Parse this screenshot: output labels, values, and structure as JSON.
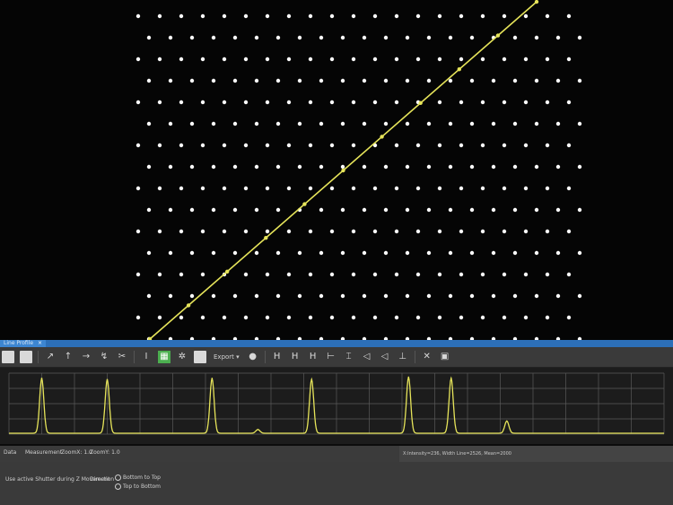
{
  "window": {
    "tab_label": "Line Profile",
    "close_glyph": "×"
  },
  "toolbar": {
    "items": [
      {
        "icon": "square-icon",
        "glyph": ""
      },
      {
        "icon": "square-icon",
        "glyph": ""
      },
      {
        "icon": "line-tool-icon",
        "glyph": "↗"
      },
      {
        "icon": "arrow-up-icon",
        "glyph": "↑"
      },
      {
        "icon": "arrow-right-icon",
        "glyph": "→"
      },
      {
        "icon": "curve-icon",
        "glyph": "↯"
      },
      {
        "icon": "scissors-icon",
        "glyph": "✂"
      },
      {
        "icon": "cursor-icon",
        "glyph": "I"
      },
      {
        "icon": "green-toggle-icon",
        "glyph": "▦"
      },
      {
        "icon": "gear-icon",
        "glyph": "✲"
      },
      {
        "icon": "export-icon",
        "glyph": ""
      },
      {
        "icon": "circle-icon",
        "glyph": "●"
      },
      {
        "icon": "h-marker-icon",
        "glyph": "H"
      },
      {
        "icon": "h-marker-icon",
        "glyph": "H"
      },
      {
        "icon": "h-marker-icon",
        "glyph": "H"
      },
      {
        "icon": "bracket-icon",
        "glyph": "⊢"
      },
      {
        "icon": "text-cursor-icon",
        "glyph": "⌶"
      },
      {
        "icon": "triangle-left-icon",
        "glyph": "◁"
      },
      {
        "icon": "triangle-left-icon",
        "glyph": "◁"
      },
      {
        "icon": "pin-icon",
        "glyph": "⊥"
      },
      {
        "icon": "delete-icon",
        "glyph": "✕"
      },
      {
        "icon": "save-icon",
        "glyph": "▣"
      }
    ],
    "export_label": "Export"
  },
  "chart_data": {
    "type": "line",
    "title": "",
    "xlabel": "",
    "ylabel": "",
    "xlim": [
      0,
      1000
    ],
    "ylim": [
      0,
      1
    ],
    "grid": true,
    "series": [
      {
        "color": "#e6e45a",
        "peaks": [
          {
            "x": 50,
            "height": 0.9
          },
          {
            "x": 150,
            "height": 0.88
          },
          {
            "x": 310,
            "height": 0.9
          },
          {
            "x": 462,
            "height": 0.88
          },
          {
            "x": 610,
            "height": 0.92
          },
          {
            "x": 675,
            "height": 0.9
          },
          {
            "x": 760,
            "height": 0.2
          },
          {
            "x": 380,
            "height": 0.06
          }
        ]
      }
    ]
  },
  "status": {
    "left_tab_a": "Data",
    "left_tab_b": "Measurement",
    "zoom_x": "ZoomX: 1.0",
    "zoom_y": "ZoomY: 1.0",
    "right_text": "X:Intensity=236, Width Line=2526, Mean=2000"
  },
  "bottom_panel": {
    "option_text": "Use active Shutter during Z Movement",
    "direction_label": "Direction",
    "radio_a": "Bottom to Top",
    "radio_b": "Top to Bottom"
  },
  "colors": {
    "accent_blue": "#2c6fb8",
    "trace": "#e6e45a",
    "dots": "#ffffff"
  }
}
